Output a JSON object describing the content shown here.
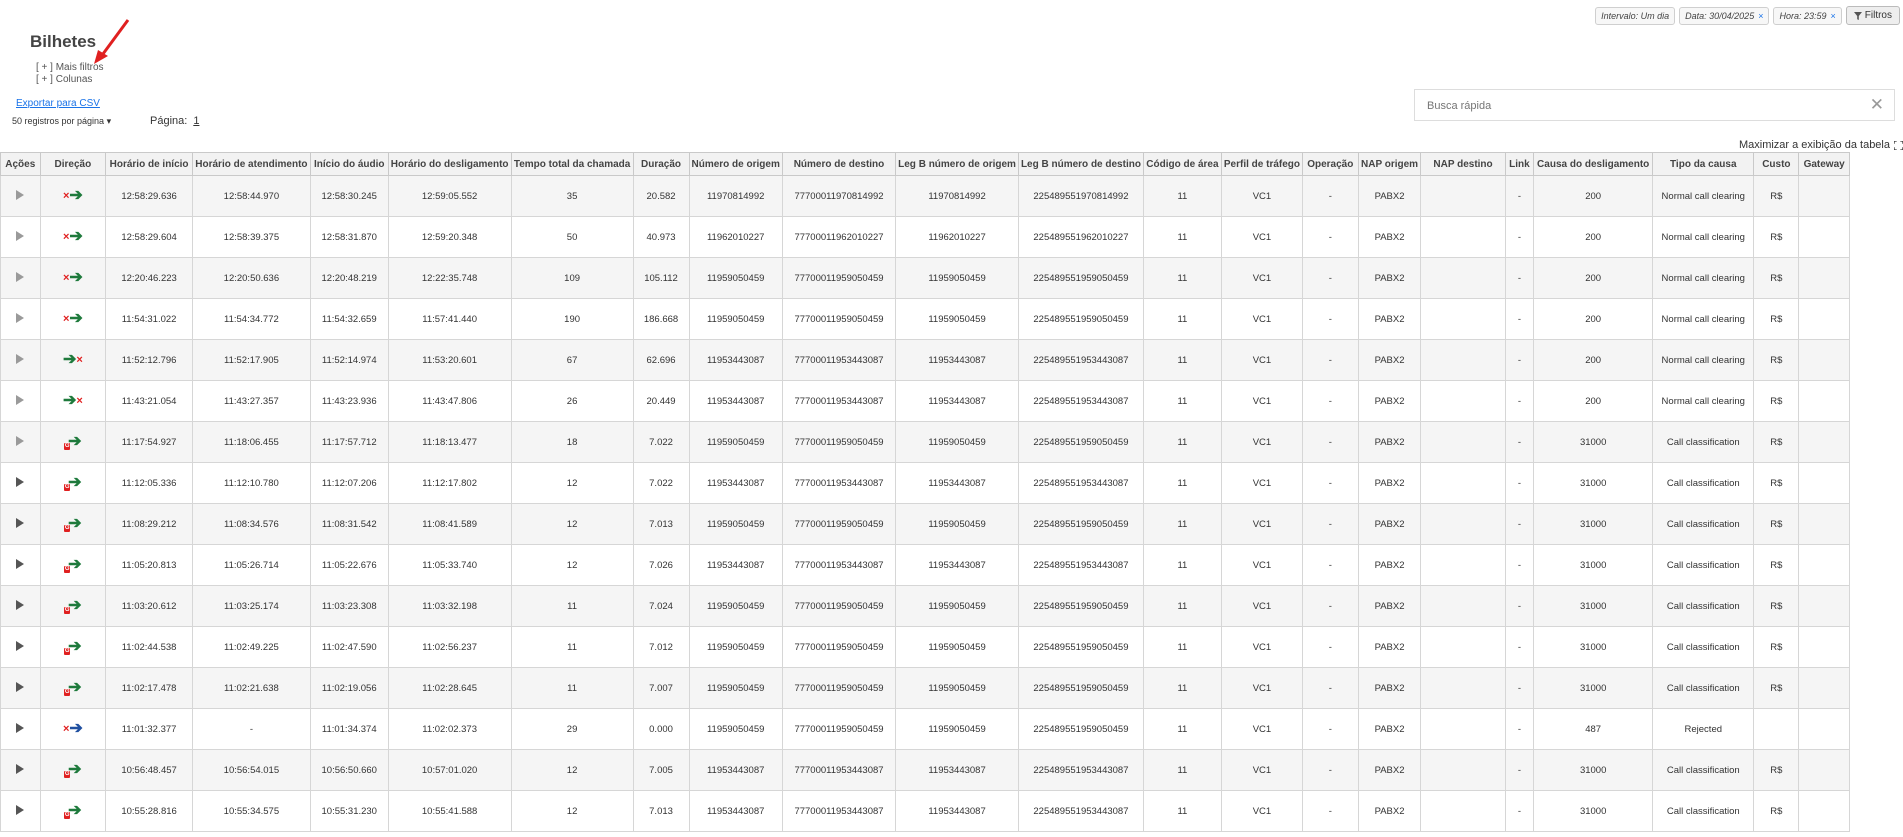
{
  "header": {
    "title": "Bilhetes",
    "more_filters": "[ + ] Mais filtros",
    "columns": "[ + ] Colunas",
    "export_csv": "Exportar para CSV",
    "per_page": "50 registros por página",
    "page_label": "Página:",
    "page_number": "1",
    "search_placeholder": "Busca rápida",
    "maximize": "Maximizar a exibição da tabela"
  },
  "filters": {
    "interval": "Intervalo: Um dia",
    "date": "Data: 30/04/2025",
    "hour": "Hora: 23:59",
    "button": "Filtros"
  },
  "table": {
    "columns": [
      "Ações",
      "Direção",
      "Horário de início",
      "Horário de atendimento",
      "Início do áudio",
      "Horário do desligamento",
      "Tempo total da chamada",
      "Duração",
      "Número de origem",
      "Número de destino",
      "Leg B número de origem",
      "Leg B número de destino",
      "Código de área",
      "Perfil de tráfego",
      "Operação",
      "NAP origem",
      "NAP destino",
      "Link",
      "Causa do desligamento",
      "Tipo da causa",
      "Custo",
      "Gateway"
    ],
    "rows": [
      {
        "play": "light",
        "dir": "x-green",
        "start": "12:58:29.636",
        "answer": "12:58:44.970",
        "audio": "12:58:30.245",
        "hangup": "12:59:05.552",
        "total": "35",
        "dur": "20.582",
        "orig": "11970814992",
        "dest": "77700011970814992",
        "lbo": "11970814992",
        "lbd": "225489551970814992",
        "area": "11",
        "prof": "VC1",
        "op": "-",
        "napo": "PABX2",
        "napd": "",
        "link": "-",
        "cause": "200",
        "type": "Normal call clearing",
        "cost": "R$",
        "gw": ""
      },
      {
        "play": "light",
        "dir": "x-green",
        "start": "12:58:29.604",
        "answer": "12:58:39.375",
        "audio": "12:58:31.870",
        "hangup": "12:59:20.348",
        "total": "50",
        "dur": "40.973",
        "orig": "11962010227",
        "dest": "77700011962010227",
        "lbo": "11962010227",
        "lbd": "225489551962010227",
        "area": "11",
        "prof": "VC1",
        "op": "-",
        "napo": "PABX2",
        "napd": "",
        "link": "-",
        "cause": "200",
        "type": "Normal call clearing",
        "cost": "R$",
        "gw": ""
      },
      {
        "play": "light",
        "dir": "x-green",
        "start": "12:20:46.223",
        "answer": "12:20:50.636",
        "audio": "12:20:48.219",
        "hangup": "12:22:35.748",
        "total": "109",
        "dur": "105.112",
        "orig": "11959050459",
        "dest": "77700011959050459",
        "lbo": "11959050459",
        "lbd": "225489551959050459",
        "area": "11",
        "prof": "VC1",
        "op": "-",
        "napo": "PABX2",
        "napd": "",
        "link": "-",
        "cause": "200",
        "type": "Normal call clearing",
        "cost": "R$",
        "gw": ""
      },
      {
        "play": "light",
        "dir": "x-green",
        "start": "11:54:31.022",
        "answer": "11:54:34.772",
        "audio": "11:54:32.659",
        "hangup": "11:57:41.440",
        "total": "190",
        "dur": "186.668",
        "orig": "11959050459",
        "dest": "77700011959050459",
        "lbo": "11959050459",
        "lbd": "225489551959050459",
        "area": "11",
        "prof": "VC1",
        "op": "-",
        "napo": "PABX2",
        "napd": "",
        "link": "-",
        "cause": "200",
        "type": "Normal call clearing",
        "cost": "R$",
        "gw": ""
      },
      {
        "play": "light",
        "dir": "green-x",
        "start": "11:52:12.796",
        "answer": "11:52:17.905",
        "audio": "11:52:14.974",
        "hangup": "11:53:20.601",
        "total": "67",
        "dur": "62.696",
        "orig": "11953443087",
        "dest": "77700011953443087",
        "lbo": "11953443087",
        "lbd": "225489551953443087",
        "area": "11",
        "prof": "VC1",
        "op": "-",
        "napo": "PABX2",
        "napd": "",
        "link": "-",
        "cause": "200",
        "type": "Normal call clearing",
        "cost": "R$",
        "gw": ""
      },
      {
        "play": "light",
        "dir": "green-x",
        "start": "11:43:21.054",
        "answer": "11:43:27.357",
        "audio": "11:43:23.936",
        "hangup": "11:43:47.806",
        "total": "26",
        "dur": "20.449",
        "orig": "11953443087",
        "dest": "77700011953443087",
        "lbo": "11953443087",
        "lbd": "225489551953443087",
        "area": "11",
        "prof": "VC1",
        "op": "-",
        "napo": "PABX2",
        "napd": "",
        "link": "-",
        "cause": "200",
        "type": "Normal call clearing",
        "cost": "R$",
        "gw": ""
      },
      {
        "play": "light",
        "dir": "badge",
        "start": "11:17:54.927",
        "answer": "11:18:06.455",
        "audio": "11:17:57.712",
        "hangup": "11:18:13.477",
        "total": "18",
        "dur": "7.022",
        "orig": "11959050459",
        "dest": "77700011959050459",
        "lbo": "11959050459",
        "lbd": "225489551959050459",
        "area": "11",
        "prof": "VC1",
        "op": "-",
        "napo": "PABX2",
        "napd": "",
        "link": "-",
        "cause": "31000",
        "type": "Call classification",
        "cost": "R$",
        "gw": ""
      },
      {
        "play": "dark",
        "dir": "badge",
        "start": "11:12:05.336",
        "answer": "11:12:10.780",
        "audio": "11:12:07.206",
        "hangup": "11:12:17.802",
        "total": "12",
        "dur": "7.022",
        "orig": "11953443087",
        "dest": "77700011953443087",
        "lbo": "11953443087",
        "lbd": "225489551953443087",
        "area": "11",
        "prof": "VC1",
        "op": "-",
        "napo": "PABX2",
        "napd": "",
        "link": "-",
        "cause": "31000",
        "type": "Call classification",
        "cost": "R$",
        "gw": ""
      },
      {
        "play": "dark",
        "dir": "badge",
        "start": "11:08:29.212",
        "answer": "11:08:34.576",
        "audio": "11:08:31.542",
        "hangup": "11:08:41.589",
        "total": "12",
        "dur": "7.013",
        "orig": "11959050459",
        "dest": "77700011959050459",
        "lbo": "11959050459",
        "lbd": "225489551959050459",
        "area": "11",
        "prof": "VC1",
        "op": "-",
        "napo": "PABX2",
        "napd": "",
        "link": "-",
        "cause": "31000",
        "type": "Call classification",
        "cost": "R$",
        "gw": ""
      },
      {
        "play": "dark",
        "dir": "badge",
        "start": "11:05:20.813",
        "answer": "11:05:26.714",
        "audio": "11:05:22.676",
        "hangup": "11:05:33.740",
        "total": "12",
        "dur": "7.026",
        "orig": "11953443087",
        "dest": "77700011953443087",
        "lbo": "11953443087",
        "lbd": "225489551953443087",
        "area": "11",
        "prof": "VC1",
        "op": "-",
        "napo": "PABX2",
        "napd": "",
        "link": "-",
        "cause": "31000",
        "type": "Call classification",
        "cost": "R$",
        "gw": ""
      },
      {
        "play": "dark",
        "dir": "badge",
        "start": "11:03:20.612",
        "answer": "11:03:25.174",
        "audio": "11:03:23.308",
        "hangup": "11:03:32.198",
        "total": "11",
        "dur": "7.024",
        "orig": "11959050459",
        "dest": "77700011959050459",
        "lbo": "11959050459",
        "lbd": "225489551959050459",
        "area": "11",
        "prof": "VC1",
        "op": "-",
        "napo": "PABX2",
        "napd": "",
        "link": "-",
        "cause": "31000",
        "type": "Call classification",
        "cost": "R$",
        "gw": ""
      },
      {
        "play": "dark",
        "dir": "badge",
        "start": "11:02:44.538",
        "answer": "11:02:49.225",
        "audio": "11:02:47.590",
        "hangup": "11:02:56.237",
        "total": "11",
        "dur": "7.012",
        "orig": "11959050459",
        "dest": "77700011959050459",
        "lbo": "11959050459",
        "lbd": "225489551959050459",
        "area": "11",
        "prof": "VC1",
        "op": "-",
        "napo": "PABX2",
        "napd": "",
        "link": "-",
        "cause": "31000",
        "type": "Call classification",
        "cost": "R$",
        "gw": ""
      },
      {
        "play": "dark",
        "dir": "badge",
        "start": "11:02:17.478",
        "answer": "11:02:21.638",
        "audio": "11:02:19.056",
        "hangup": "11:02:28.645",
        "total": "11",
        "dur": "7.007",
        "orig": "11959050459",
        "dest": "77700011959050459",
        "lbo": "11959050459",
        "lbd": "225489551959050459",
        "area": "11",
        "prof": "VC1",
        "op": "-",
        "napo": "PABX2",
        "napd": "",
        "link": "-",
        "cause": "31000",
        "type": "Call classification",
        "cost": "R$",
        "gw": ""
      },
      {
        "play": "dark",
        "dir": "x-blue",
        "start": "11:01:32.377",
        "answer": "-",
        "audio": "11:01:34.374",
        "hangup": "11:02:02.373",
        "total": "29",
        "dur": "0.000",
        "orig": "11959050459",
        "dest": "77700011959050459",
        "lbo": "11959050459",
        "lbd": "225489551959050459",
        "area": "11",
        "prof": "VC1",
        "op": "-",
        "napo": "PABX2",
        "napd": "",
        "link": "-",
        "cause": "487",
        "type": "Rejected",
        "cost": "",
        "gw": ""
      },
      {
        "play": "dark",
        "dir": "badge",
        "start": "10:56:48.457",
        "answer": "10:56:54.015",
        "audio": "10:56:50.660",
        "hangup": "10:57:01.020",
        "total": "12",
        "dur": "7.005",
        "orig": "11953443087",
        "dest": "77700011953443087",
        "lbo": "11953443087",
        "lbd": "225489551953443087",
        "area": "11",
        "prof": "VC1",
        "op": "-",
        "napo": "PABX2",
        "napd": "",
        "link": "-",
        "cause": "31000",
        "type": "Call classification",
        "cost": "R$",
        "gw": ""
      },
      {
        "play": "dark",
        "dir": "badge",
        "start": "10:55:28.816",
        "answer": "10:55:34.575",
        "audio": "10:55:31.230",
        "hangup": "10:55:41.588",
        "total": "12",
        "dur": "7.013",
        "orig": "11953443087",
        "dest": "77700011953443087",
        "lbo": "11953443087",
        "lbd": "225489551953443087",
        "area": "11",
        "prof": "VC1",
        "op": "-",
        "napo": "PABX2",
        "napd": "",
        "link": "-",
        "cause": "31000",
        "type": "Call classification",
        "cost": "R$",
        "gw": ""
      }
    ]
  },
  "colors": {
    "accent": "#1a73e8",
    "green": "#1e7a3c",
    "red": "#e02020",
    "blue": "#1f4fa0",
    "annotation": "#e02020"
  }
}
